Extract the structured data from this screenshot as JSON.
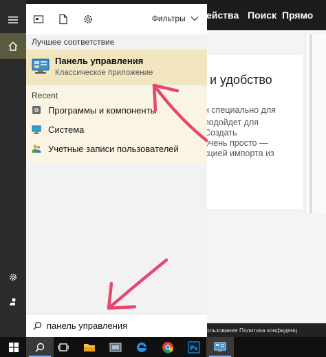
{
  "website": {
    "nav": [
      "ейства",
      "Поиск",
      "Прямо"
    ],
    "heading": "и удобство",
    "text_lines": [
      "н специально для",
      "подойдет для",
      "Создать",
      "очень просто —",
      "кцией импорта из"
    ],
    "footer": "ользования   Политика конфиденц"
  },
  "start": {
    "filters_label": "Фильтры",
    "best_match_label": "Лучшее соответствие",
    "best_match": {
      "title": "Панель управления",
      "subtitle": "Классическое приложение"
    },
    "recent_label": "Recent",
    "recent_items": [
      {
        "label": "Программы и компоненты",
        "icon": "programs-icon"
      },
      {
        "label": "Система",
        "icon": "system-icon"
      },
      {
        "label": "Учетные записи пользователей",
        "icon": "users-icon"
      }
    ],
    "search_value": "панель управления"
  },
  "taskbar": {
    "apps": [
      "start-icon",
      "search-icon",
      "task-view-icon",
      "explorer-icon",
      "virtualbox-icon",
      "edge-icon",
      "chrome-icon",
      "photoshop-icon",
      "control-panel-icon"
    ]
  },
  "colors": {
    "best_match_bg": "#f2e6c1",
    "annotation_arrow": "#e8466f",
    "rail_bg": "#2b2b2b",
    "taskbar_bg": "#101010"
  }
}
